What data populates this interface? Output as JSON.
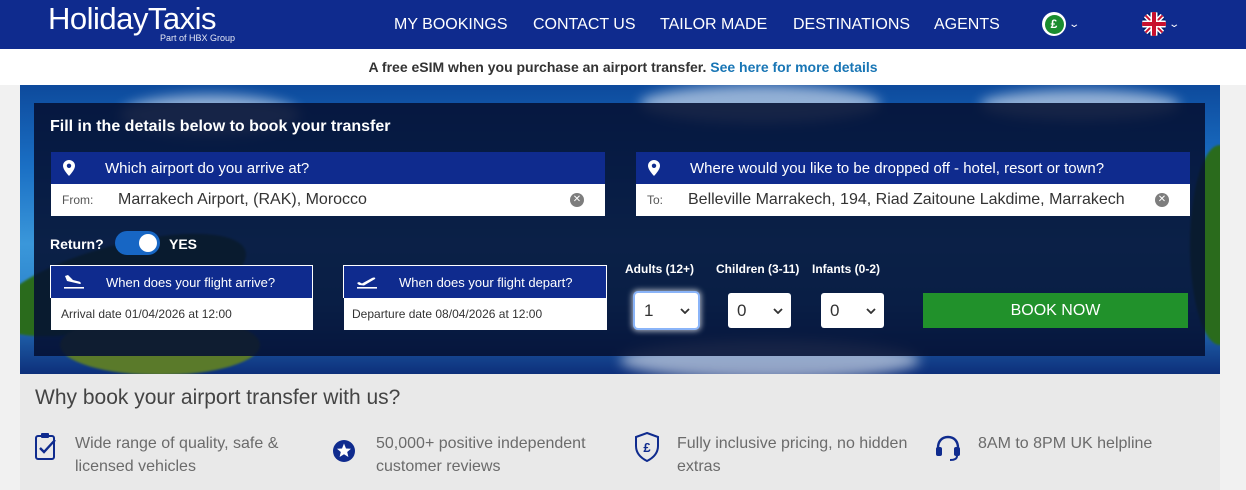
{
  "header": {
    "logo_main": "HolidayTaxis",
    "logo_sub": "Part of HBX Group",
    "nav": [
      "MY BOOKINGS",
      "CONTACT US",
      "TAILOR MADE",
      "DESTINATIONS",
      "AGENTS"
    ],
    "currency_symbol": "£",
    "colors": {
      "header": "#0f2b8e",
      "accent_green": "#21912b",
      "link": "#1976b5"
    }
  },
  "promo": {
    "text": "A free eSIM when you purchase an airport transfer.",
    "link": "See here for more details"
  },
  "booking": {
    "title": "Fill in the details below to book your transfer",
    "arrival": {
      "question": "Which airport do you arrive at?",
      "label": "From:",
      "value": "Marrakech Airport, (RAK), Morocco"
    },
    "dropoff": {
      "question": "Where would you like to be dropped off - hotel, resort or town?",
      "label": "To:",
      "value": "Belleville Marrakech, 194, Riad Zaitoune Lakdime, Marrakech"
    },
    "return": {
      "label": "Return?",
      "value": "YES"
    },
    "flight_arrive": {
      "label": "When does your flight arrive?",
      "value": "Arrival date 01/04/2026 at 12:00"
    },
    "flight_depart": {
      "label": "When does your flight depart?",
      "value": "Departure date 08/04/2026 at 12:00"
    },
    "adults": {
      "label": "Adults (12+)",
      "value": "1"
    },
    "children": {
      "label": "Children (3-11)",
      "value": "0"
    },
    "infants": {
      "label": "Infants (0-2)",
      "value": "0"
    },
    "button": "BOOK NOW"
  },
  "why": {
    "title": "Why book your airport transfer with us?",
    "features": [
      {
        "icon": "clipboard-check-icon",
        "text": "Wide range of quality, safe & licensed vehicles"
      },
      {
        "icon": "star-badge-icon",
        "text": "50,000+ positive independent customer reviews"
      },
      {
        "icon": "pound-shield-icon",
        "text": "Fully inclusive pricing, no hidden extras"
      },
      {
        "icon": "headset-icon",
        "text": "8AM to 8PM UK helpline"
      }
    ]
  }
}
